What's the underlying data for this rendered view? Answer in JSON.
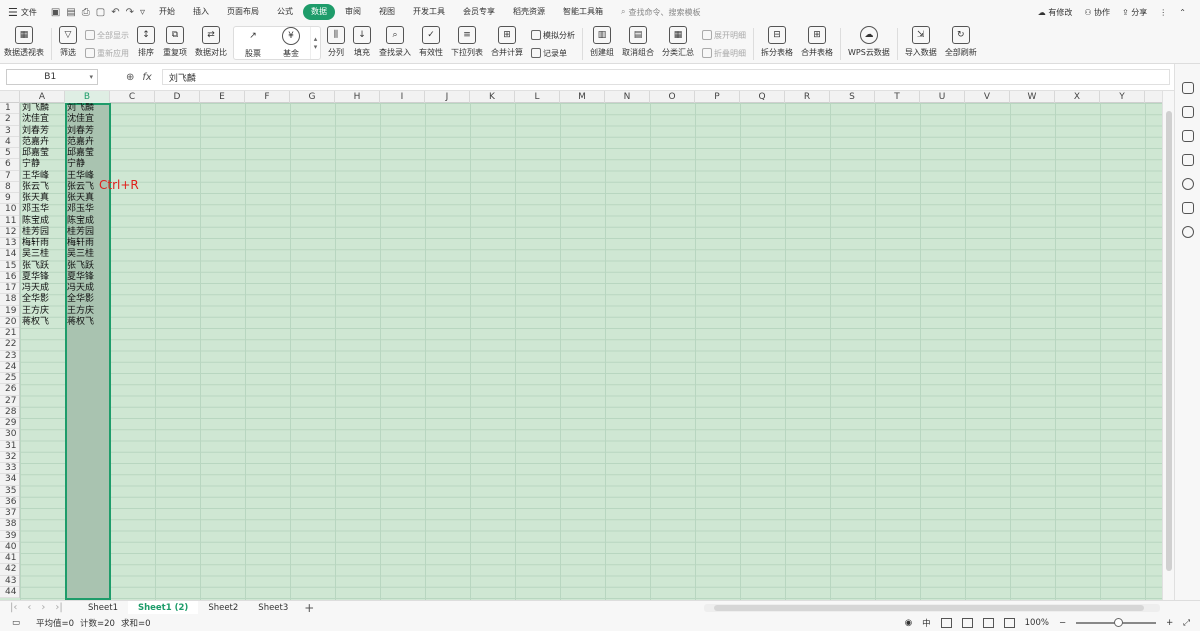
{
  "menubar": {
    "file_label": "文件",
    "tabs": [
      "开始",
      "插入",
      "页面布局",
      "公式",
      "数据",
      "审阅",
      "视图",
      "开发工具",
      "会员专享",
      "稻壳资源",
      "智能工具箱"
    ],
    "active_tab": "数据",
    "search_placeholder": "查找命令、搜索模板",
    "right": {
      "changes": "有修改",
      "collab": "协作",
      "share": "分享"
    }
  },
  "ribbon": {
    "pivot": "数据透视表",
    "filter": "筛选",
    "show_all": "全部显示",
    "reapply": "重新应用",
    "sort": "排序",
    "dup": "重复项",
    "compare": "数据对比",
    "stock": "股票",
    "fund": "基金",
    "split": "分列",
    "fill": "填充",
    "lookup": "查找录入",
    "validity": "有效性",
    "dropdown": "下拉列表",
    "merge_calc": "合并计算",
    "simulate": "模拟分析",
    "record": "记录单",
    "group": "创建组",
    "ungroup": "取消组合",
    "subtotal": "分类汇总",
    "expand": "展开明细",
    "collapse": "折叠明细",
    "split_table": "拆分表格",
    "merge_table": "合并表格",
    "wps_cloud": "WPS云数据",
    "import": "导入数据",
    "refresh_all": "全部刷新"
  },
  "formula": {
    "cell_ref": "B1",
    "content": "刘飞麟"
  },
  "columns": [
    "A",
    "B",
    "C",
    "D",
    "E",
    "F",
    "G",
    "H",
    "I",
    "J",
    "K",
    "L",
    "M",
    "N",
    "O",
    "P",
    "Q",
    "R",
    "S",
    "T",
    "U",
    "V",
    "W",
    "X",
    "Y"
  ],
  "selected_column": "B",
  "rows": [
    "1",
    "2",
    "3",
    "4",
    "5",
    "6",
    "7",
    "8",
    "9",
    "10",
    "11",
    "12",
    "13",
    "14",
    "15",
    "16",
    "17",
    "18",
    "19",
    "20",
    "21",
    "22",
    "23",
    "24",
    "25",
    "26",
    "27",
    "28",
    "29",
    "30",
    "31",
    "32",
    "33",
    "34",
    "35",
    "36",
    "37",
    "38",
    "39",
    "40",
    "41",
    "42",
    "43",
    "44"
  ],
  "col_a": [
    "刘飞麟",
    "沈佳宜",
    "刘春芳",
    "范嘉卉",
    "邱嘉莹",
    "宁静",
    "王华峰",
    "张云飞",
    "张天真",
    "邓玉华",
    "陈宝成",
    "桂芳园",
    "梅轩雨",
    "吴三桂",
    "张飞跃",
    "夏华锋",
    "冯天成",
    "全华影",
    "王方庆",
    "蒋权飞"
  ],
  "col_b": [
    "刘飞麟",
    "沈佳宜",
    "刘春芳",
    "范嘉卉",
    "邱嘉莹",
    "宁静",
    "王华峰",
    "张云飞",
    "张天真",
    "邓玉华",
    "陈宝成",
    "桂芳园",
    "梅轩雨",
    "吴三桂",
    "张飞跃",
    "夏华锋",
    "冯天成",
    "全华影",
    "王方庆",
    "蒋权飞"
  ],
  "hint": "Ctrl+R",
  "sheets": [
    "Sheet1",
    "Sheet1 (2)",
    "Sheet2",
    "Sheet3"
  ],
  "active_sheet": "Sheet1 (2)",
  "status": {
    "avg": "平均值=0",
    "count": "计数=20",
    "sum": "求和=0",
    "zoom": "100%"
  },
  "accent": "#1e9c6a"
}
